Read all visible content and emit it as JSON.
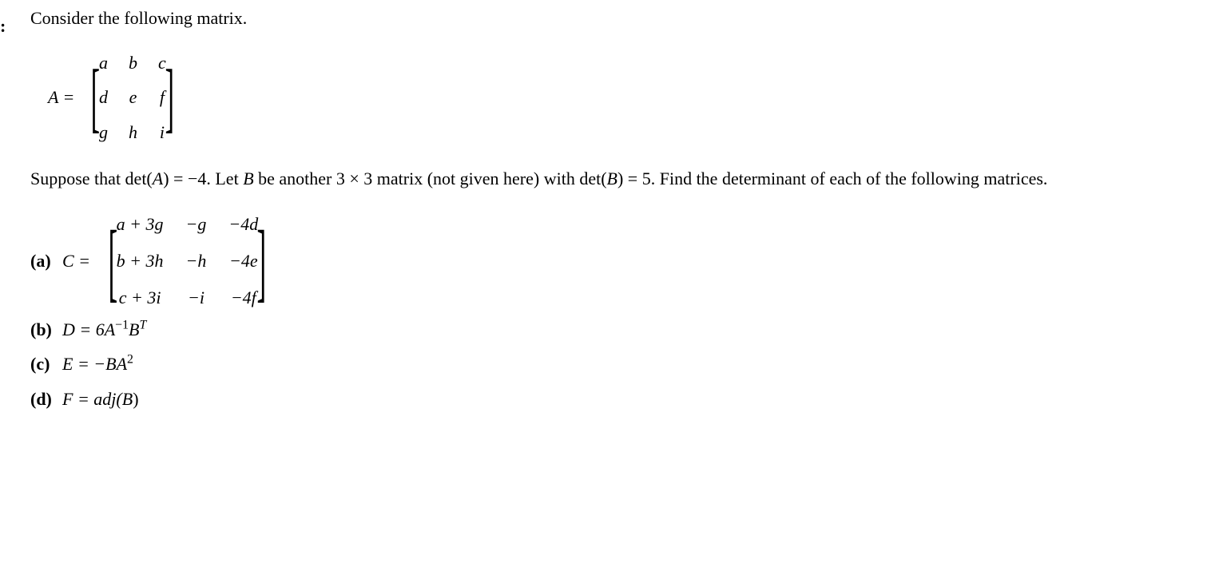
{
  "marker": ":",
  "intro": "Consider the following matrix.",
  "matrixA": {
    "lhs": "A =",
    "cells": [
      "a",
      "b",
      "c",
      "d",
      "e",
      "f",
      "g",
      "h",
      "i"
    ]
  },
  "suppose_pre": "Suppose that det(",
  "suppose_Avar": "A",
  "suppose_mid1": ") = −4. Let ",
  "suppose_Bvar": "B",
  "suppose_mid2": " be another 3 × 3 matrix (not given here) with det(",
  "suppose_Bvar2": "B",
  "suppose_tail": ") = 5. Find the determinant of each of the following matrices.",
  "parts": {
    "a": {
      "label": "(a)",
      "lhs": "C =",
      "cells": [
        "a + 3g",
        "−g",
        "−4d",
        "b + 3h",
        "−h",
        "−4e",
        "c + 3i",
        "−i",
        "−4f"
      ]
    },
    "b": {
      "label": "(b)",
      "text_pre": "D = 6",
      "var1": "A",
      "sup1": "−1",
      "var2": "B",
      "sup2": "T"
    },
    "c": {
      "label": "(c)",
      "text_pre": "E = −",
      "var1": "B",
      "var2": "A",
      "sup2": "2"
    },
    "d": {
      "label": "(d)",
      "text_pre": "F = adj(",
      "var1": "B",
      "text_post": ")"
    }
  }
}
